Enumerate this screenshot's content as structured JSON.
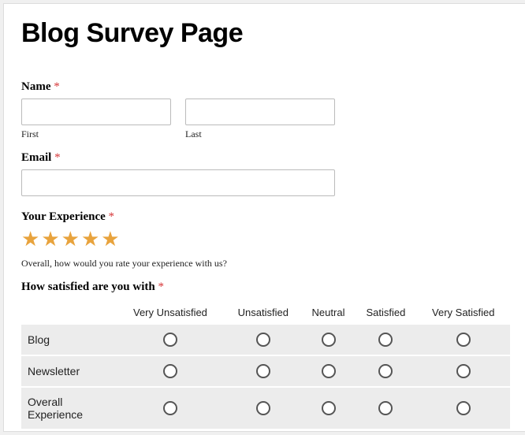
{
  "title": "Blog Survey Page",
  "name": {
    "label": "Name",
    "required": "*",
    "first_sub": "First",
    "last_sub": "Last",
    "first_value": "",
    "last_value": ""
  },
  "email": {
    "label": "Email",
    "required": "*",
    "value": ""
  },
  "experience": {
    "label": "Your Experience",
    "required": "*",
    "caption": "Overall, how would you rate your experience with us?",
    "star_count": 5
  },
  "satisfaction": {
    "label": "How satisfied are you with",
    "required": "*",
    "columns": [
      "Very Unsatisfied",
      "Unsatisfied",
      "Neutral",
      "Satisfied",
      "Very Satisfied"
    ],
    "rows": [
      "Blog",
      "Newsletter",
      "Overall Experience"
    ]
  }
}
